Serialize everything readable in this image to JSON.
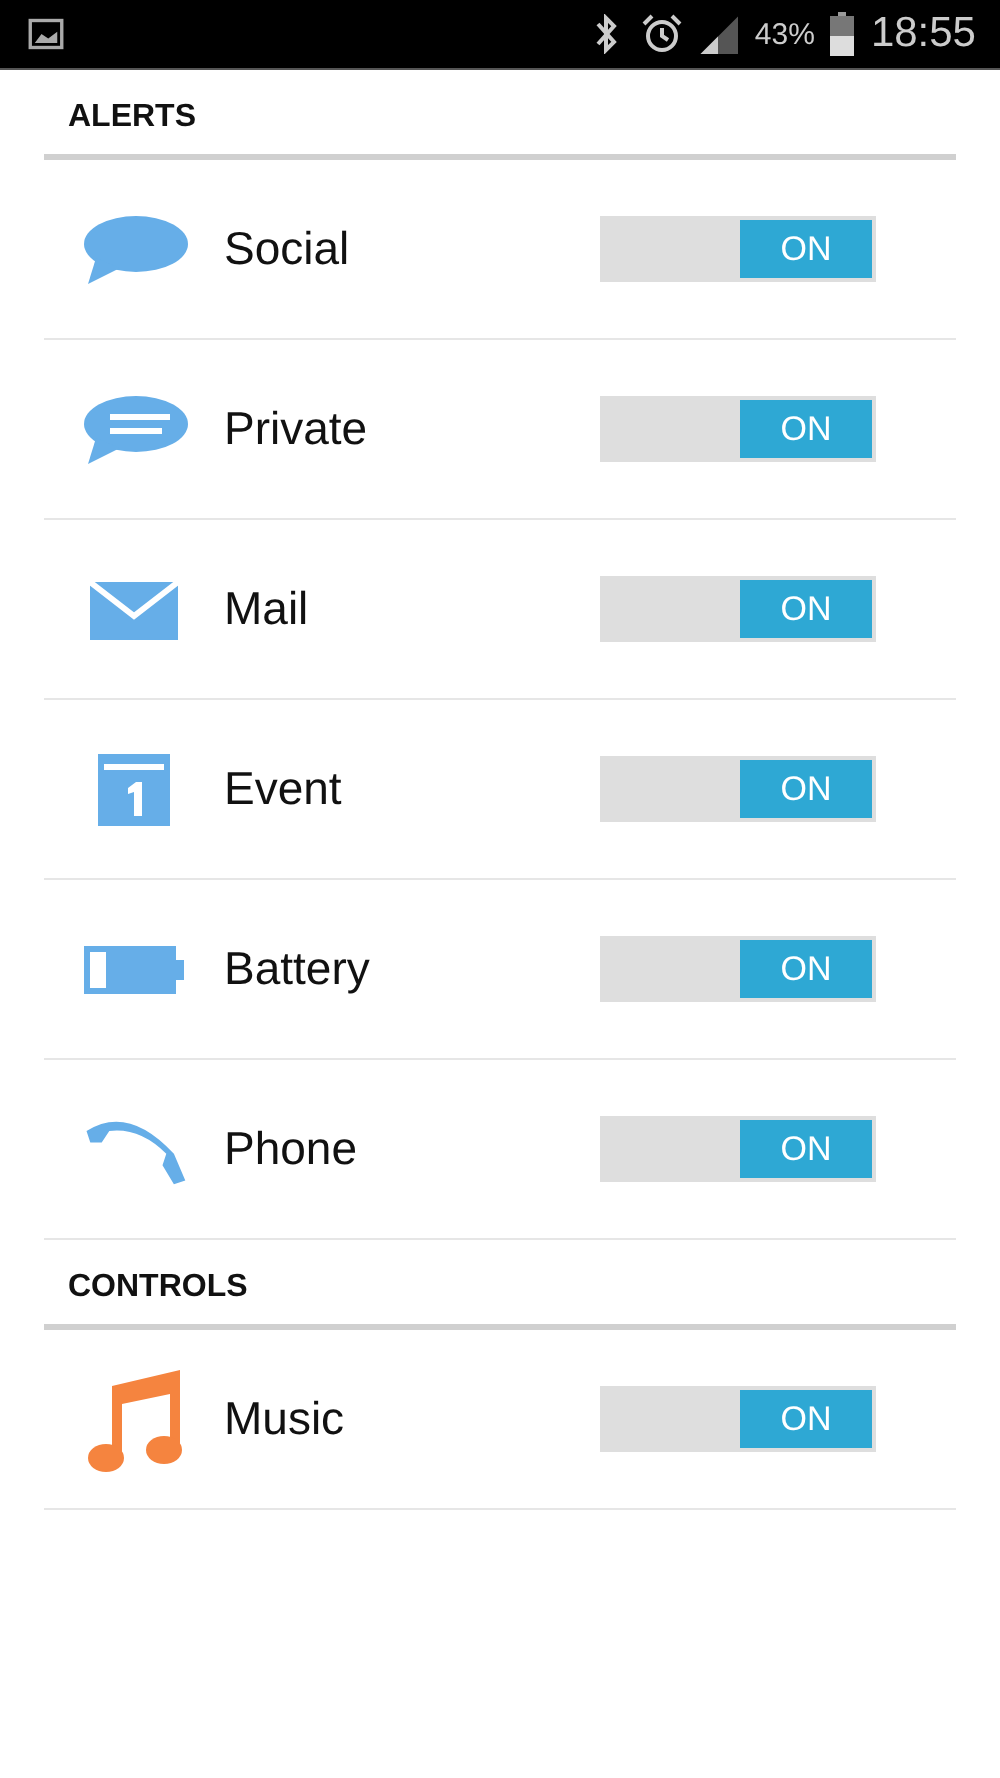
{
  "status_bar": {
    "battery_percent": "43%",
    "time": "18:55"
  },
  "sections": [
    {
      "title": "ALERTS",
      "items": [
        {
          "kind": "social",
          "label": "Social",
          "on": true,
          "switch_label": "ON"
        },
        {
          "kind": "private",
          "label": "Private",
          "on": true,
          "switch_label": "ON"
        },
        {
          "kind": "mail",
          "label": "Mail",
          "on": true,
          "switch_label": "ON"
        },
        {
          "kind": "event",
          "label": "Event",
          "on": true,
          "switch_label": "ON"
        },
        {
          "kind": "battery",
          "label": "Battery",
          "on": true,
          "switch_label": "ON"
        },
        {
          "kind": "phone",
          "label": "Phone",
          "on": true,
          "switch_label": "ON"
        }
      ]
    },
    {
      "title": "CONTROLS",
      "items": [
        {
          "kind": "music",
          "label": "Music",
          "on": true,
          "switch_label": "ON"
        }
      ]
    }
  ]
}
